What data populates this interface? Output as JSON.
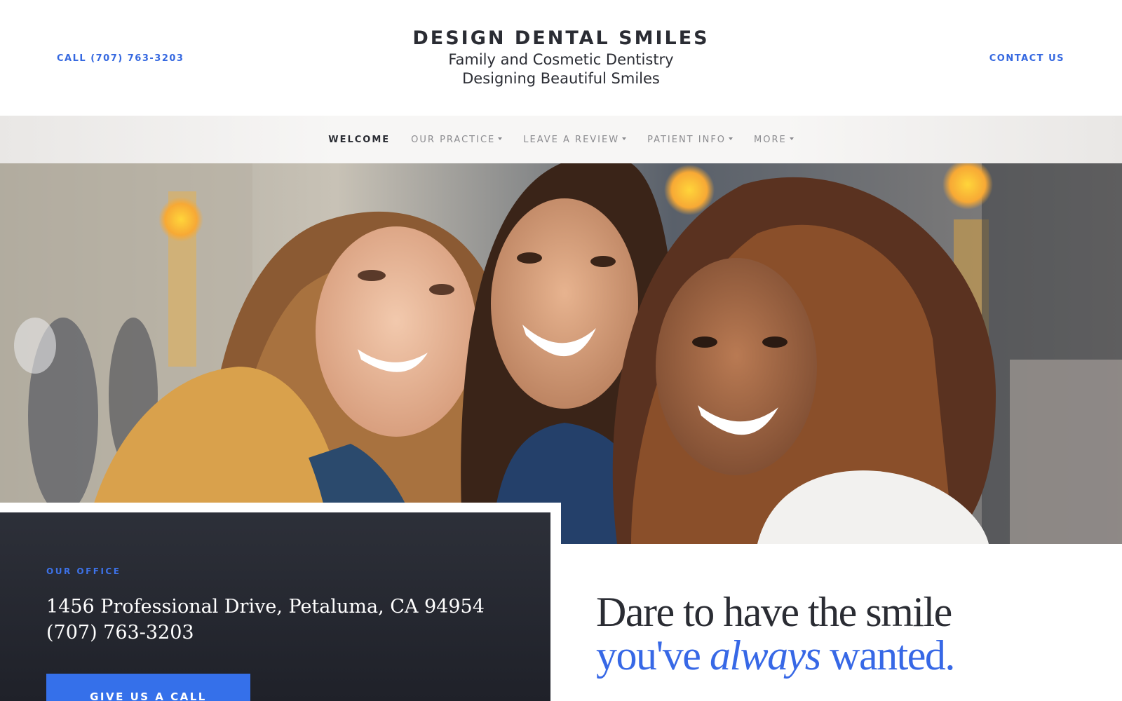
{
  "header": {
    "call_link": "CALL (707) 763-3203",
    "contact_link": "CONTACT US",
    "brand_title": "DESIGN DENTAL SMILES",
    "brand_subtitle_1": "Family and Cosmetic Dentistry",
    "brand_subtitle_2": "Designing Beautiful Smiles"
  },
  "nav": {
    "items": [
      {
        "label": "WELCOME",
        "active": true,
        "dropdown": false
      },
      {
        "label": "OUR PRACTICE",
        "active": false,
        "dropdown": true
      },
      {
        "label": "LEAVE A REVIEW",
        "active": false,
        "dropdown": true
      },
      {
        "label": "PATIENT INFO",
        "active": false,
        "dropdown": true
      },
      {
        "label": "MORE",
        "active": false,
        "dropdown": true
      }
    ]
  },
  "office": {
    "label": "OUR OFFICE",
    "address": "1456 Professional Drive, Petaluma, CA 94954",
    "phone": "(707) 763-3203",
    "button": "GIVE US A CALL"
  },
  "tagline": {
    "line1": "Dare to have the smile",
    "line2_start": "you've ",
    "line2_emph": "always",
    "line2_end": " wanted."
  },
  "colors": {
    "accent": "#3568e0",
    "dark": "#2a2c33",
    "panel": "#24262e",
    "button": "#3570ea"
  }
}
